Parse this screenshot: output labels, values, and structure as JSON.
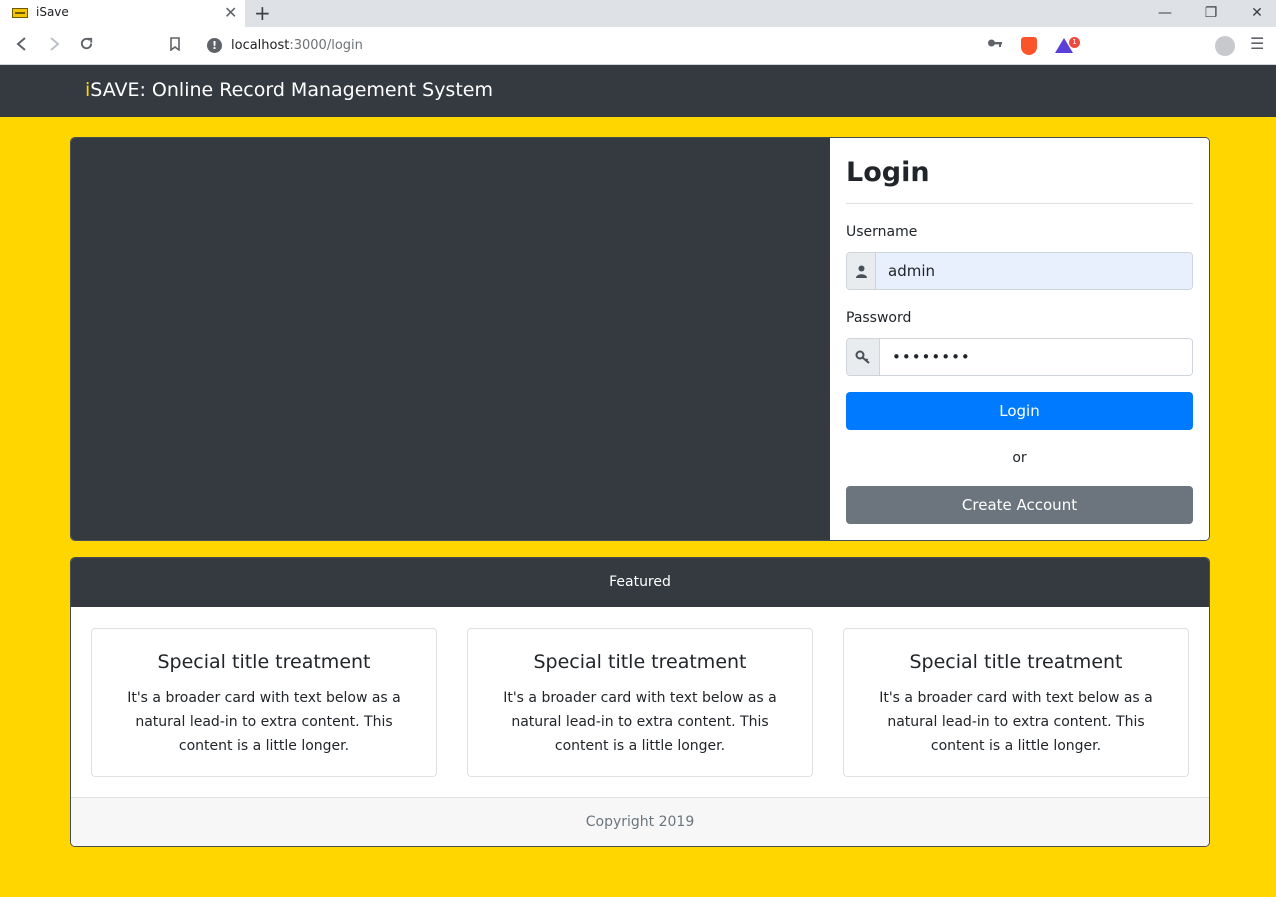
{
  "browser": {
    "tab_title": "iSave",
    "tab_close": "✕",
    "new_tab": "+",
    "url_host": "localhost",
    "url_rest": ":3000/login",
    "brave_badge": "1",
    "window_controls": {
      "minimize": "—",
      "restore": "❐",
      "close": "✕"
    },
    "icons": {
      "back": "back-icon",
      "forward": "forward-icon",
      "reload": "reload-icon",
      "bookmark": "bookmark-icon",
      "info": "info-icon",
      "key": "key-icon",
      "brave": "brave-lion-icon",
      "rewards": "brave-rewards-icon",
      "profile": "profile-icon",
      "menu": "menu-icon"
    }
  },
  "navbar": {
    "brand_accent": "i",
    "brand_rest": "SAVE: Online Record Management System"
  },
  "login": {
    "title": "Login",
    "username_label": "Username",
    "username_value": "admin",
    "password_label": "Password",
    "password_value": "••••••••",
    "login_button": "Login",
    "or_text": "or",
    "create_account_button": "Create Account",
    "icons": {
      "username": "user-icon",
      "password": "key-icon"
    }
  },
  "featured": {
    "header": "Featured",
    "cards": [
      {
        "title": "Special title treatment",
        "text": "It's a broader card with text below as a natural lead-in to extra content. This content is a little longer."
      },
      {
        "title": "Special title treatment",
        "text": "It's a broader card with text below as a natural lead-in to extra content. This content is a little longer."
      },
      {
        "title": "Special title treatment",
        "text": "It's a broader card with text below as a natural lead-in to extra content. This content is a little longer."
      }
    ],
    "footer": "Copyright 2019"
  },
  "colors": {
    "page_background": "#ffd600",
    "navbar": "#343a40",
    "brand_accent": "#ffd600",
    "primary": "#007bff",
    "secondary": "#6c757d"
  }
}
